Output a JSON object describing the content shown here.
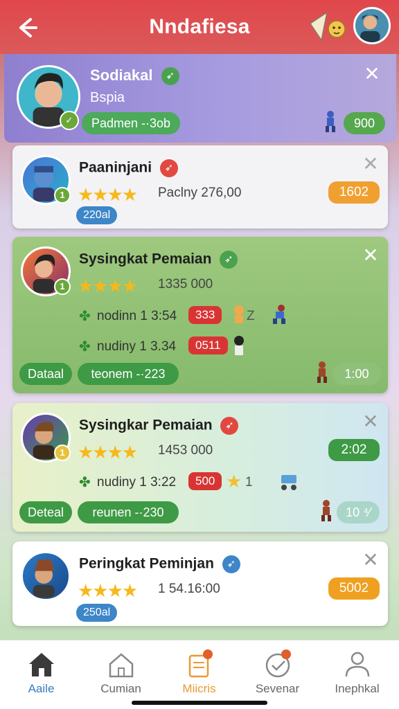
{
  "header": {
    "title": "Nndafiesa"
  },
  "profile": {
    "name": "Sodiakal",
    "sub": "Bspia",
    "tag": "Padmen -·3ob",
    "points": "900"
  },
  "cards": [
    {
      "name": "Paaninjani",
      "stars": "★★★★",
      "score": "Paclny 276,00",
      "badge": "1602",
      "tag": "220al",
      "level": "1"
    },
    {
      "name": "Sysingkat Pemaian",
      "stars": "★★★★",
      "score": "1335 000",
      "row1_text": "nodinn 1 3:54",
      "row1_badge": "333",
      "row1_extra": "Z",
      "row2_text": "nudiny 1 3.34",
      "row2_badge": "0511",
      "detail": "Dataal",
      "action": "teonem -·223",
      "count": "1:00",
      "level": "1"
    },
    {
      "name": "Sysingkar Pemaian",
      "stars": "★★★★",
      "score": "1453 000",
      "badge": "2:02",
      "row1_text": "nudiny 1 3:22",
      "row1_badge": "500",
      "row1_extra": "1",
      "detail": "Deteal",
      "action": "reunen -·230",
      "count": "10 ⁴⁄",
      "level": "1"
    },
    {
      "name": "Peringkat Peminjan",
      "stars": "★★★★",
      "score": "1 54.16:00",
      "badge": "5002",
      "tag": "250al"
    }
  ],
  "nav": [
    {
      "label": "Aaile",
      "active": true
    },
    {
      "label": "Cumian",
      "active": false
    },
    {
      "label": "Miicris",
      "active": false
    },
    {
      "label": "Sevenar",
      "active": false
    },
    {
      "label": "Inephkal",
      "active": false
    }
  ],
  "colors": {
    "accent_red": "#e0474c",
    "green": "#3e9a45",
    "orange": "#f0a030",
    "blue": "#3d86c8",
    "nav_active": "#3a7ac0"
  }
}
